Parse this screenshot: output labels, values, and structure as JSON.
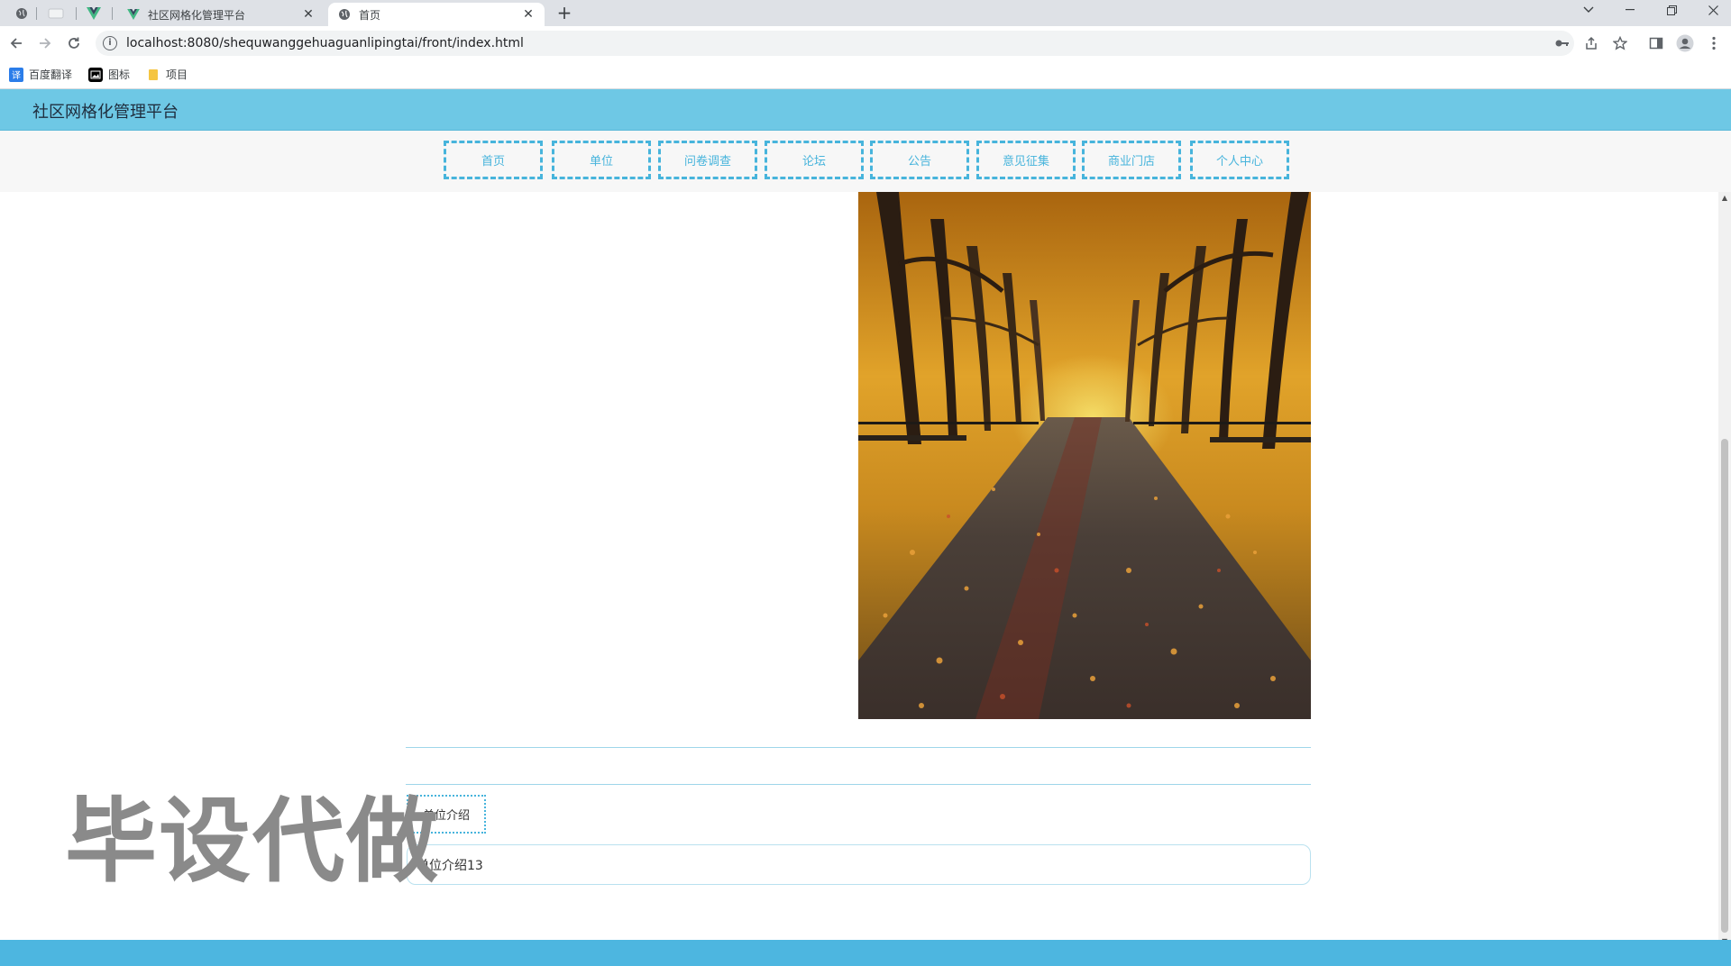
{
  "browser": {
    "tabs": [
      {
        "title": "社区网格化管理平台",
        "close": "✕"
      },
      {
        "title": "首页",
        "close": "✕"
      }
    ],
    "new_tab": "+",
    "url": "localhost:8080/shequwanggehuaguanlipingtai/front/index.html",
    "bookmarks": [
      {
        "label": "百度翻译",
        "color": "#2b7de9"
      },
      {
        "label": "图标",
        "color": "#000000"
      },
      {
        "label": "项目",
        "color": "#f5c542"
      }
    ]
  },
  "site": {
    "title": "社区网格化管理平台",
    "accent": "#47b4dc",
    "header_color": "#6ec8e5",
    "nav": [
      "首页",
      "单位",
      "问卷调查",
      "论坛",
      "公告",
      "意见征集",
      "商业门店",
      "个人中心"
    ]
  },
  "content": {
    "section_label": "单位介绍",
    "section_value": "单位介绍13"
  },
  "overlay": {
    "watermark": "毕设代做"
  },
  "icons": {
    "back": "arrow-left-icon",
    "forward": "arrow-right-icon",
    "reload": "reload-icon",
    "info": "info-icon",
    "key": "key-icon",
    "share": "share-icon",
    "star": "star-icon",
    "sidebar": "sidebar-icon",
    "profile": "profile-icon",
    "menu": "kebab-menu-icon"
  }
}
